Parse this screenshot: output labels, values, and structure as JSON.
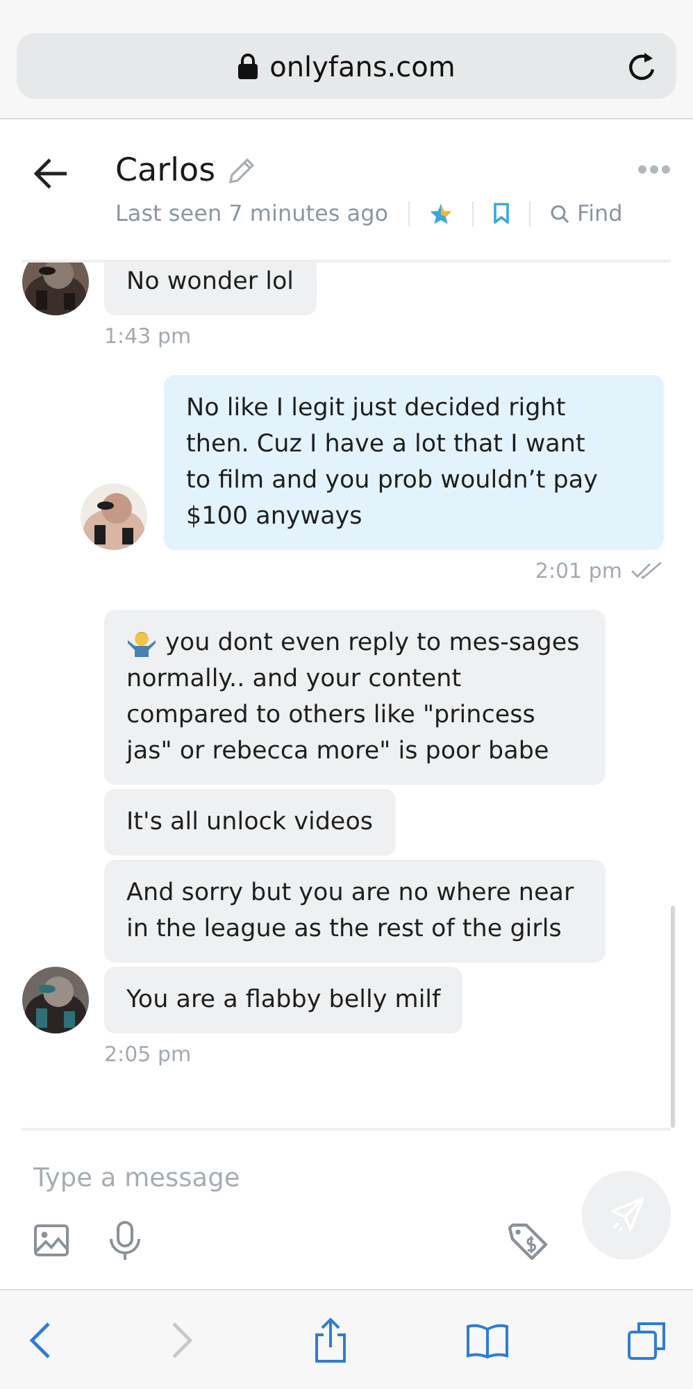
{
  "browser": {
    "url": "onlyfans.com"
  },
  "chat_header": {
    "name": "Carlos",
    "status": "Last seen 7 minutes ago",
    "find_label": "Find"
  },
  "messages": [
    {
      "kind": "incoming",
      "text": "No wonder lol",
      "avatar": true,
      "time": "1:43 pm"
    },
    {
      "kind": "outgoing",
      "text": "No like I legit just decided right then. Cuz I have a lot that I want to film and you prob wouldn’t pay $100 anyways",
      "avatar": true,
      "time": "2:01 pm",
      "read": true
    },
    {
      "kind": "incoming",
      "text": "you dont even reply to mes-sages normally.. and your content compared to others like \"princess jas\" or rebecca more\" is poor babe",
      "has_emoji": true,
      "avatar": false
    },
    {
      "kind": "incoming",
      "text": "It's all unlock videos",
      "avatar": false
    },
    {
      "kind": "incoming",
      "text": "And sorry but you are no where near in the league as the rest of the girls",
      "avatar": false
    },
    {
      "kind": "incoming",
      "text": "You are a flabby belly milf",
      "avatar": true,
      "time": "2:05 pm"
    }
  ],
  "composer": {
    "placeholder": "Type a message",
    "send_disabled": true
  },
  "browser_toolbar": [
    {
      "kind": "back",
      "disabled": false
    },
    {
      "kind": "forward",
      "disabled": true
    },
    {
      "kind": "share",
      "disabled": false
    },
    {
      "kind": "bookmarks",
      "disabled": false
    },
    {
      "kind": "tabs",
      "disabled": false
    }
  ]
}
